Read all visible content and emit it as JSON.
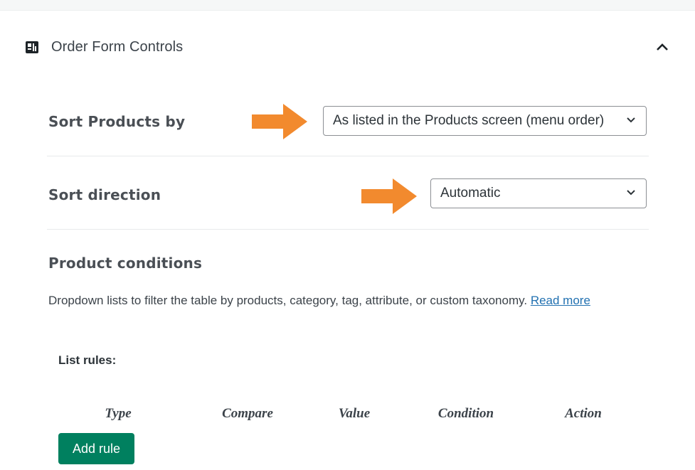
{
  "panel": {
    "title": "Order Form Controls",
    "icon": "plugin-logo-icon",
    "toggle_icon": "chevron-up-icon"
  },
  "sort_products": {
    "label": "Sort Products by",
    "value": "As listed in the Products screen (menu order)"
  },
  "sort_direction": {
    "label": "Sort direction",
    "value": "Automatic"
  },
  "product_conditions": {
    "title": "Product conditions",
    "description": "Dropdown lists to filter the table by products, category, tag, attribute, or custom taxonomy.",
    "link_text": "Read more"
  },
  "rules": {
    "label": "List rules:",
    "columns": [
      "Type",
      "Compare",
      "Value",
      "Condition",
      "Action"
    ],
    "add_button": "Add rule"
  },
  "colors": {
    "arrow": "#f28a2e",
    "add_button": "#00805f",
    "link": "#2271b1"
  }
}
